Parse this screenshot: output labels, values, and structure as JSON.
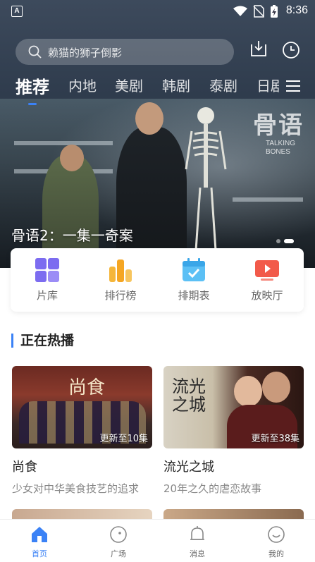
{
  "status_bar": {
    "time": "8:36",
    "badge": "A"
  },
  "search": {
    "placeholder": "赖猫的狮子倒影"
  },
  "header_icons": [
    "download-icon",
    "history-icon"
  ],
  "tabs": [
    {
      "label": "推荐",
      "active": true
    },
    {
      "label": "内地"
    },
    {
      "label": "美剧"
    },
    {
      "label": "韩剧"
    },
    {
      "label": "泰剧"
    },
    {
      "label": "日剧"
    }
  ],
  "banner": {
    "title": "骨语2：一集一奇案",
    "watermark": "骨语",
    "watermark_en": "TALKING\nBONES",
    "active_dot": 1,
    "dot_count": 2
  },
  "quick_links": [
    {
      "label": "片库",
      "icon": "library-icon"
    },
    {
      "label": "排行榜",
      "icon": "ranking-icon"
    },
    {
      "label": "排期表",
      "icon": "calendar-icon"
    },
    {
      "label": "放映厅",
      "icon": "screening-icon"
    }
  ],
  "section": {
    "title": "正在热播"
  },
  "cards": [
    {
      "title": "尚食",
      "desc": "少女对中华美食技艺的追求",
      "update": "更新至10集",
      "poster_text": "尚食"
    },
    {
      "title": "流光之城",
      "desc": "20年之久的虐恋故事",
      "update": "更新至38集",
      "poster_text": "流光之城"
    }
  ],
  "bottom_nav": [
    {
      "label": "首页",
      "icon": "home-icon",
      "active": true
    },
    {
      "label": "广场",
      "icon": "plaza-icon"
    },
    {
      "label": "消息",
      "icon": "bell-icon"
    },
    {
      "label": "我的",
      "icon": "profile-icon"
    }
  ],
  "colors": {
    "accent": "#3b82f6"
  }
}
